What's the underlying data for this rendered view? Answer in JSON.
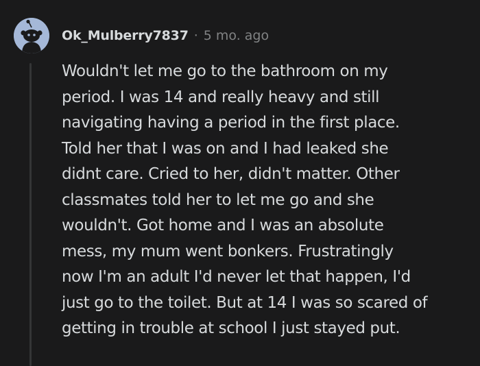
{
  "comment": {
    "username": "Ok_Mulberry7837",
    "separator": "·",
    "timestamp": "5 mo. ago",
    "avatar_icon": "snoo-avatar-icon",
    "avatar_bg": "#a5b8d8",
    "body_lines": [
      "Wouldn't let me go to the bathroom on my",
      "period. I was 14 and really heavy and still",
      "navigating having a period in the first place.",
      "Told her that I was on and I had leaked she",
      "didnt care. Cried to her, didn't matter. Other",
      "classmates told her to let me go and she",
      "wouldn't. Got home and I was an absolute",
      "mess, my mum went bonkers. Frustratingly",
      "now I'm an adult I'd never let that happen, I'd",
      "just go to the toilet. But at 14 I was so scared of",
      "getting in trouble at school I just stayed put."
    ]
  }
}
